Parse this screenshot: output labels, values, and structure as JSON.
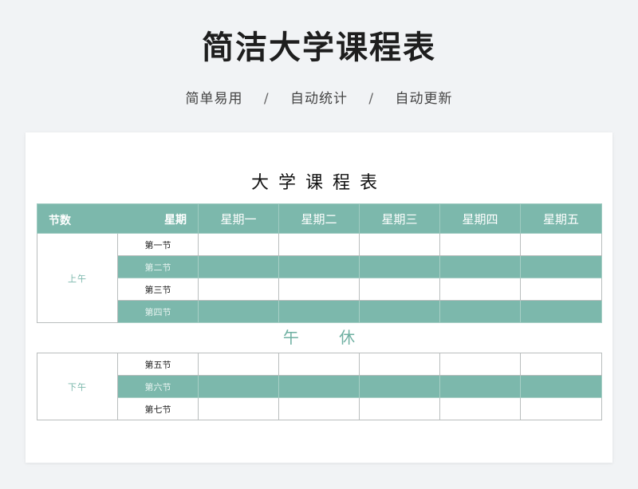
{
  "header": {
    "title": "简洁大学课程表",
    "tags": [
      "简单易用",
      "自动统计",
      "自动更新"
    ],
    "separator": "/"
  },
  "sheet": {
    "title": "大学课程表",
    "corner": {
      "left": "节数",
      "right": "星期"
    },
    "days": [
      "星期一",
      "星期二",
      "星期三",
      "星期四",
      "星期五"
    ],
    "morning": {
      "label": "上午",
      "periods": [
        "第一节",
        "第二节",
        "第三节",
        "第四节"
      ]
    },
    "noon_break": [
      "午",
      "休"
    ],
    "afternoon": {
      "label": "下午",
      "periods": [
        "第五节",
        "第六节",
        "第七节"
      ]
    }
  },
  "colors": {
    "accent": "#7cb8ac",
    "text_dark": "#1e1e1e",
    "background": "#f1f3f5"
  }
}
